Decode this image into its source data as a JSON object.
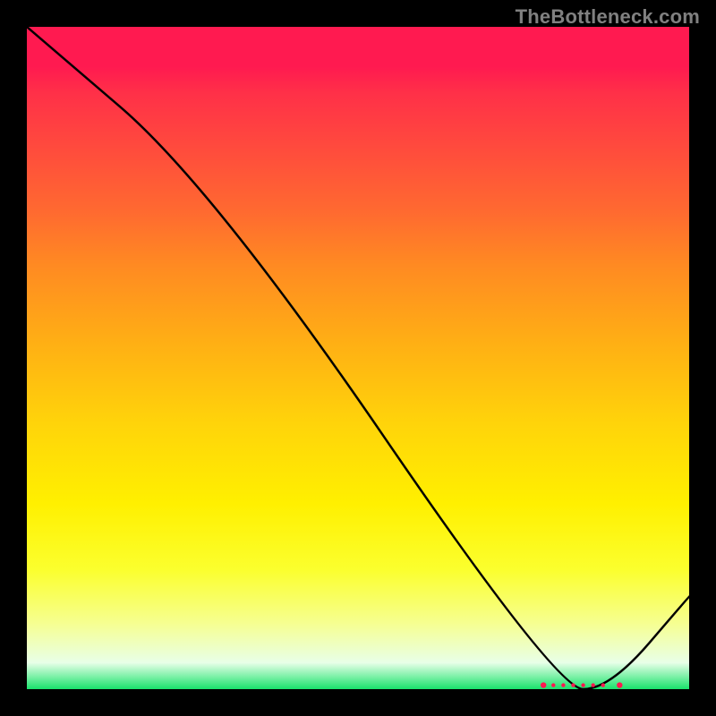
{
  "watermark": "TheBottleneck.com",
  "chart_data": {
    "type": "line",
    "title": "",
    "xlabel": "",
    "ylabel": "",
    "xlim": [
      0,
      100
    ],
    "ylim": [
      0,
      100
    ],
    "series": [
      {
        "name": "curve",
        "x": [
          0,
          28,
          80,
          88,
          100
        ],
        "y": [
          100,
          76,
          0,
          0,
          14
        ]
      }
    ],
    "markers": {
      "name": "bottom-dots",
      "x": [
        78,
        79.5,
        81,
        82.5,
        84,
        85.5,
        87,
        89.5
      ],
      "y": [
        0.6,
        0.6,
        0.6,
        0.6,
        0.6,
        0.6,
        0.6,
        0.6
      ],
      "color": "#ff1a50"
    }
  }
}
